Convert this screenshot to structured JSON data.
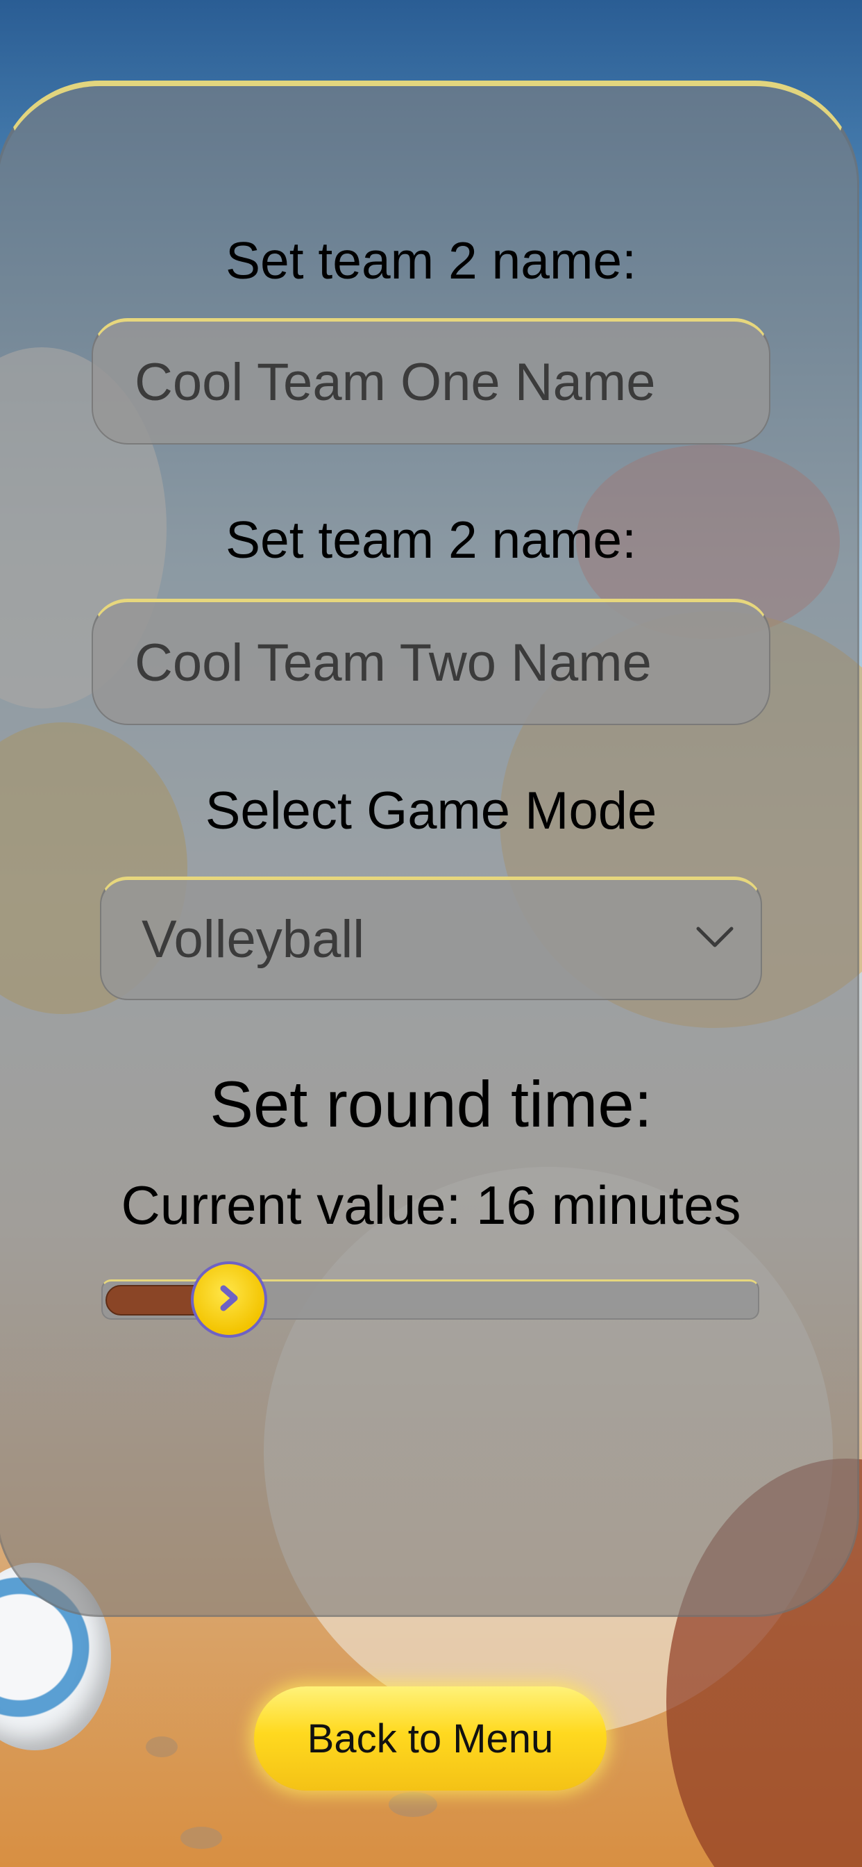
{
  "form": {
    "team1_label": "Set team 2 name:",
    "team1_value": "Cool Team One Name",
    "team2_label": "Set team 2 name:",
    "team2_value": "Cool Team Two Name",
    "mode_label": "Select Game Mode",
    "mode_selected": "Volleyball",
    "round_label": "Set round time:",
    "round_value_text": "Current value: 16 minutes",
    "round_minutes": 16,
    "slider_fraction": 0.15
  },
  "footer": {
    "back_label": "Back to Menu"
  },
  "icons": {
    "dropdown": "chevron-down-icon",
    "slider_thumb": "chevron-right-icon"
  },
  "colors": {
    "panel_border": "#e2d57e",
    "slider_fill": "#8a4526",
    "thumb": "#ffd91f",
    "thumb_arrow": "#6e62c4",
    "button": "#ffd91f"
  }
}
